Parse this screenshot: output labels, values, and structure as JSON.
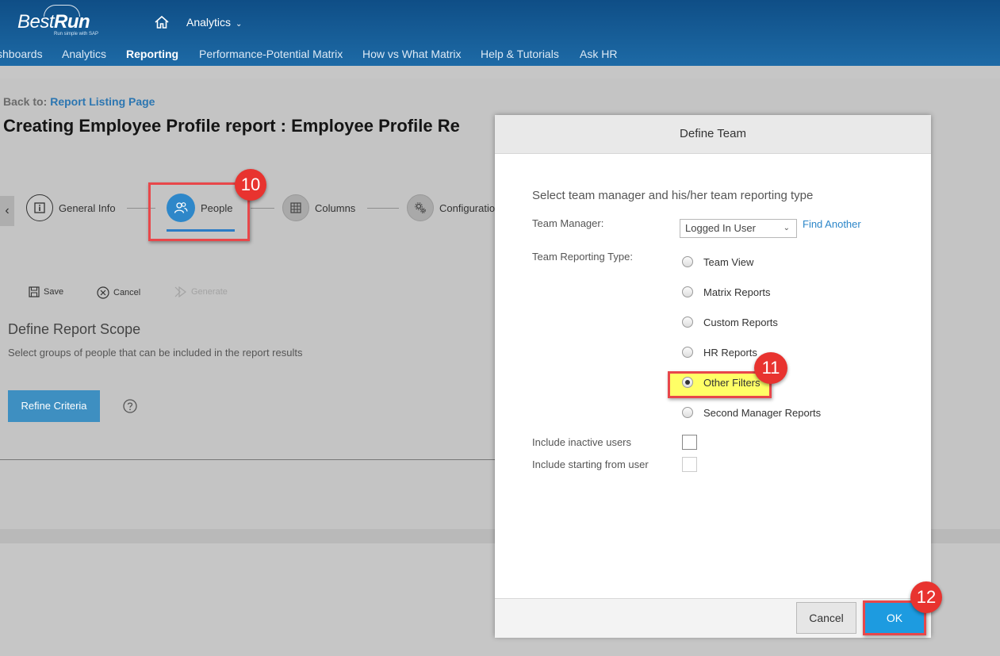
{
  "header": {
    "logo_light": "Best",
    "logo_bold": "Run",
    "logo_tagline": "Run simple with SAP",
    "analytics_menu_label": "Analytics",
    "nav": [
      "shboards",
      "Analytics",
      "Reporting",
      "Performance-Potential Matrix",
      "How vs What Matrix",
      "Help & Tutorials",
      "Ask HR"
    ],
    "active_nav": "Reporting"
  },
  "page": {
    "back_to_label": "Back to:",
    "back_to_link": "Report Listing Page",
    "title": "Creating Employee Profile report : Employee Profile Re",
    "steps": [
      {
        "label": "General Info",
        "icon": "info-icon"
      },
      {
        "label": "People",
        "icon": "people-icon"
      },
      {
        "label": "Columns",
        "icon": "columns-icon"
      },
      {
        "label": "Configuratio",
        "icon": "gear-icon"
      }
    ],
    "toolbar": {
      "save": "Save",
      "cancel": "Cancel",
      "generate": "Generate"
    },
    "section_title": "Define Report Scope",
    "section_subtitle": "Select groups of people that can be included in the report results",
    "refine_button": "Refine Criteria"
  },
  "annotations": {
    "people_step": "10",
    "other_filters": "11",
    "ok_button": "12"
  },
  "dialog": {
    "title": "Define Team",
    "heading": "Select team manager and his/her team reporting type",
    "team_manager_label": "Team Manager:",
    "team_manager_value": "Logged In User",
    "find_another": "Find Another",
    "reporting_type_label": "Team Reporting Type:",
    "reporting_types": [
      "Team View",
      "Matrix Reports",
      "Custom Reports",
      "HR Reports",
      "Other Filters",
      "Second Manager Reports"
    ],
    "selected_reporting_type": "Other Filters",
    "include_inactive_label": "Include inactive users",
    "include_starting_label": "Include starting from user",
    "cancel_button": "Cancel",
    "ok_button": "OK"
  },
  "colors": {
    "header_top": "#0f4e86",
    "header_bottom": "#1d6aa6",
    "accent_blue": "#2c86c8",
    "ok_button": "#1d9be0",
    "highlight_yellow": "#ffff66",
    "annotation_red": "#e8332f"
  }
}
